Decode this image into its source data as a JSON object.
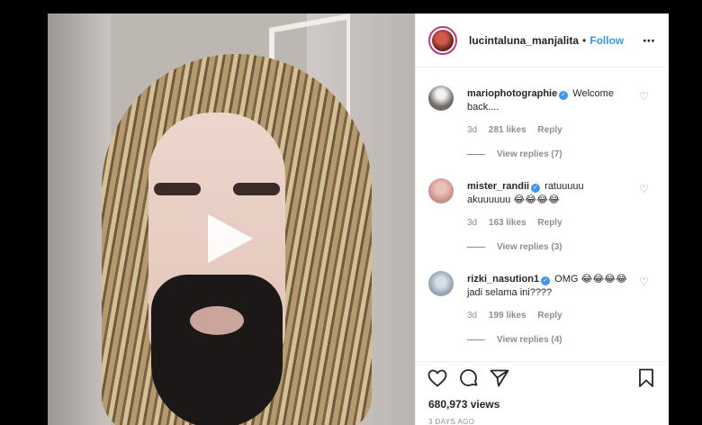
{
  "header": {
    "username": "lucintaluna_manjalita",
    "separator": "•",
    "follow_label": "Follow",
    "more_icon": "⋯"
  },
  "comments": [
    {
      "username": "mariophotographie",
      "text": "Welcome back....",
      "time": "3d",
      "likes": "281 likes",
      "reply_label": "Reply",
      "view_replies": "View replies (7)",
      "avatar_color": "#6e6a66"
    },
    {
      "username": "mister_randii",
      "text": "ratuuuuu akuuuuuu 😂😂😂😂",
      "time": "3d",
      "likes": "163 likes",
      "reply_label": "Reply",
      "view_replies": "View replies (3)",
      "avatar_color": "#c98f86"
    },
    {
      "username": "rizki_nasution1",
      "text": "OMG 😂😂😂😂 jadi selama ini????",
      "time": "3d",
      "likes": "199 likes",
      "reply_label": "Reply",
      "view_replies": "View replies (4)",
      "avatar_color": "#8fa2b4"
    }
  ],
  "footer": {
    "views": "680,973 views",
    "date": "3 DAYS AGO"
  },
  "icons": {
    "verified": "✓",
    "heart": "♡",
    "play": "play-icon",
    "comment": "comment-icon",
    "share": "share-icon",
    "save": "bookmark-icon"
  },
  "colors": {
    "accent_blue": "#3897f0",
    "text": "#262626",
    "muted": "#8e8e8e"
  }
}
